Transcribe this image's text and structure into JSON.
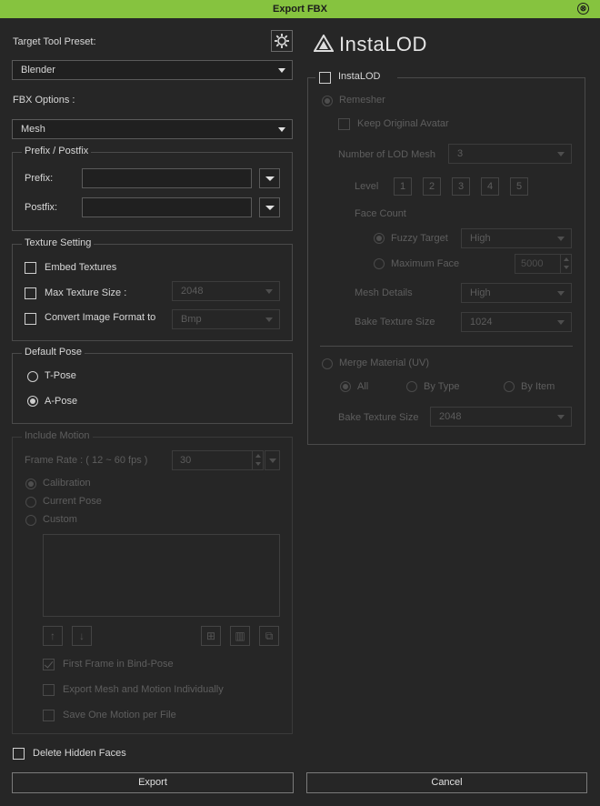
{
  "window": {
    "title": "Export FBX",
    "close_glyph": "⊗"
  },
  "left": {
    "preset_label": "Target Tool Preset:",
    "preset_value": "Blender",
    "fbx_options_label": "FBX Options :",
    "fbx_options_value": "Mesh",
    "prefix_group": {
      "title": "Prefix / Postfix",
      "prefix_label": "Prefix:",
      "postfix_label": "Postfix:",
      "prefix_value": "",
      "postfix_value": ""
    },
    "texture_group": {
      "title": "Texture Setting",
      "embed": "Embed Textures",
      "max_size": "Max Texture Size :",
      "max_size_value": "2048",
      "convert": "Convert Image Format to",
      "convert_value": "Bmp"
    },
    "pose_group": {
      "title": "Default Pose",
      "tpose": "T-Pose",
      "apose": "A-Pose"
    },
    "motion_group": {
      "title": "Include Motion",
      "frame_rate_label": "Frame Rate : ( 12 ~ 60 fps )",
      "frame_rate_value": "30",
      "calibration": "Calibration",
      "current_pose": "Current Pose",
      "custom": "Custom",
      "first_frame": "First Frame in Bind-Pose",
      "export_individually": "Export Mesh and Motion Individually",
      "save_one": "Save One Motion per File"
    },
    "delete_hidden": "Delete Hidden Faces"
  },
  "right": {
    "logo_text": "InstaLOD",
    "instalod_label": "InstaLOD",
    "remesher": "Remesher",
    "keep_avatar": "Keep Original Avatar",
    "num_lod_label": "Number of LOD Mesh",
    "num_lod_value": "3",
    "level_label": "Level",
    "levels": [
      "1",
      "2",
      "3",
      "4",
      "5"
    ],
    "face_count_label": "Face Count",
    "fuzzy_target": "Fuzzy Target",
    "fuzzy_value": "High",
    "max_face": "Maximum Face",
    "max_face_value": "5000",
    "mesh_details_label": "Mesh Details",
    "mesh_details_value": "High",
    "bake_size_label": "Bake Texture Size",
    "bake_size_value": "1024",
    "merge_material": "Merge Material (UV)",
    "merge_all": "All",
    "merge_by_type": "By Type",
    "merge_by_item": "By Item",
    "merge_bake_label": "Bake Texture Size",
    "merge_bake_value": "2048"
  },
  "footer": {
    "export": "Export",
    "cancel": "Cancel"
  }
}
